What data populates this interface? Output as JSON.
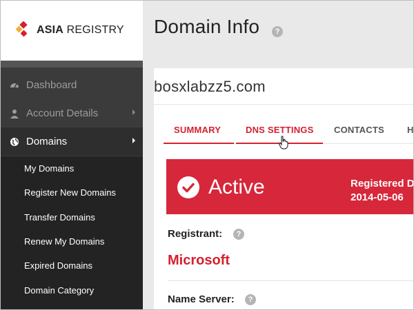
{
  "brand": {
    "name_bold": "ASIA",
    "name_rest": " REGISTRY"
  },
  "sidebar": {
    "items": [
      {
        "label": "Dashboard",
        "icon": "dashboard-icon"
      },
      {
        "label": "Account Details",
        "icon": "user-icon"
      },
      {
        "label": "Domains",
        "icon": "globe-icon"
      }
    ],
    "subitems": [
      "My Domains",
      "Register New Domains",
      "Transfer Domains",
      "Renew My Domains",
      "Expired Domains",
      "Domain Category"
    ]
  },
  "page": {
    "title": "Domain Info"
  },
  "domain": {
    "name": "bosxlabzz5.com"
  },
  "tabs": [
    {
      "label": "SUMMARY"
    },
    {
      "label": "DNS SETTINGS"
    },
    {
      "label": "CONTACTS"
    },
    {
      "label": "H"
    }
  ],
  "status": {
    "label": "Active",
    "registered_label": "Registered D",
    "registered_date": "2014-05-06"
  },
  "registrant": {
    "label": "Registrant:",
    "value": "Microsoft"
  },
  "name_server": {
    "label": "Name Server:"
  },
  "colors": {
    "accent": "#d4202f",
    "sidebar": "#3b3b3b",
    "subnav": "#232323"
  }
}
